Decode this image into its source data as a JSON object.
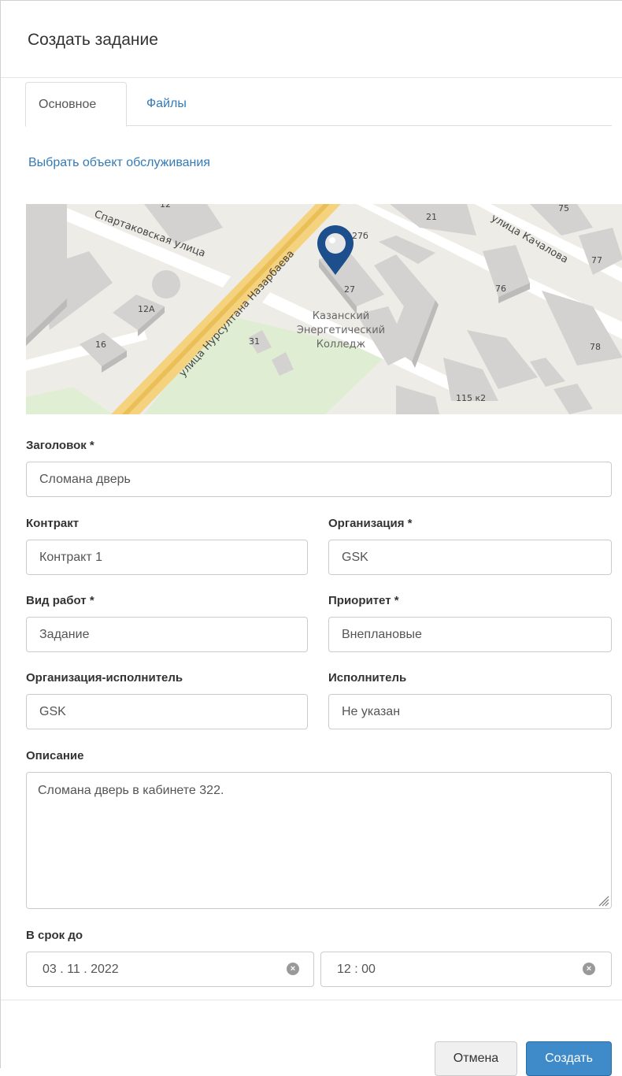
{
  "modal": {
    "title": "Создать задание"
  },
  "tabs": [
    {
      "label": "Основное",
      "active": true
    },
    {
      "label": "Файлы",
      "active": false
    }
  ],
  "select_object_link": "Выбрать объект обслуживания",
  "map": {
    "streets": [
      "Спартаковская улица",
      "улица Нурсултана Назарбаева",
      "улица Качалова"
    ],
    "place_label": [
      "Казанский",
      "Энергетический",
      "Колледж"
    ],
    "house_numbers": [
      "12",
      "12А",
      "16",
      "31",
      "27",
      "27б",
      "21",
      "75",
      "77",
      "76",
      "78",
      "115 к2"
    ],
    "marker_color": "#1c4f8c"
  },
  "form": {
    "title_label": "Заголовок *",
    "title_value": "Сломана дверь",
    "contract_label": "Контракт",
    "contract_value": "Контракт 1",
    "organization_label": "Организация *",
    "organization_value": "GSK",
    "work_type_label": "Вид работ *",
    "work_type_value": "Задание",
    "priority_label": "Приоритет *",
    "priority_value": "Внеплановые",
    "executor_org_label": "Организация-исполнитель",
    "executor_org_value": "GSK",
    "executor_label": "Исполнитель",
    "executor_value": "Не указан",
    "description_label": "Описание",
    "description_value": "Сломана дверь в кабинете 322.",
    "deadline_label": "В срок до",
    "deadline_date": "03 . 11 . 2022",
    "deadline_time": "12 : 00",
    "clear_icon": "×"
  },
  "buttons": {
    "cancel": "Отмена",
    "create": "Создать"
  },
  "colors": {
    "link": "#337ab7",
    "primary": "#3f8ac9"
  }
}
